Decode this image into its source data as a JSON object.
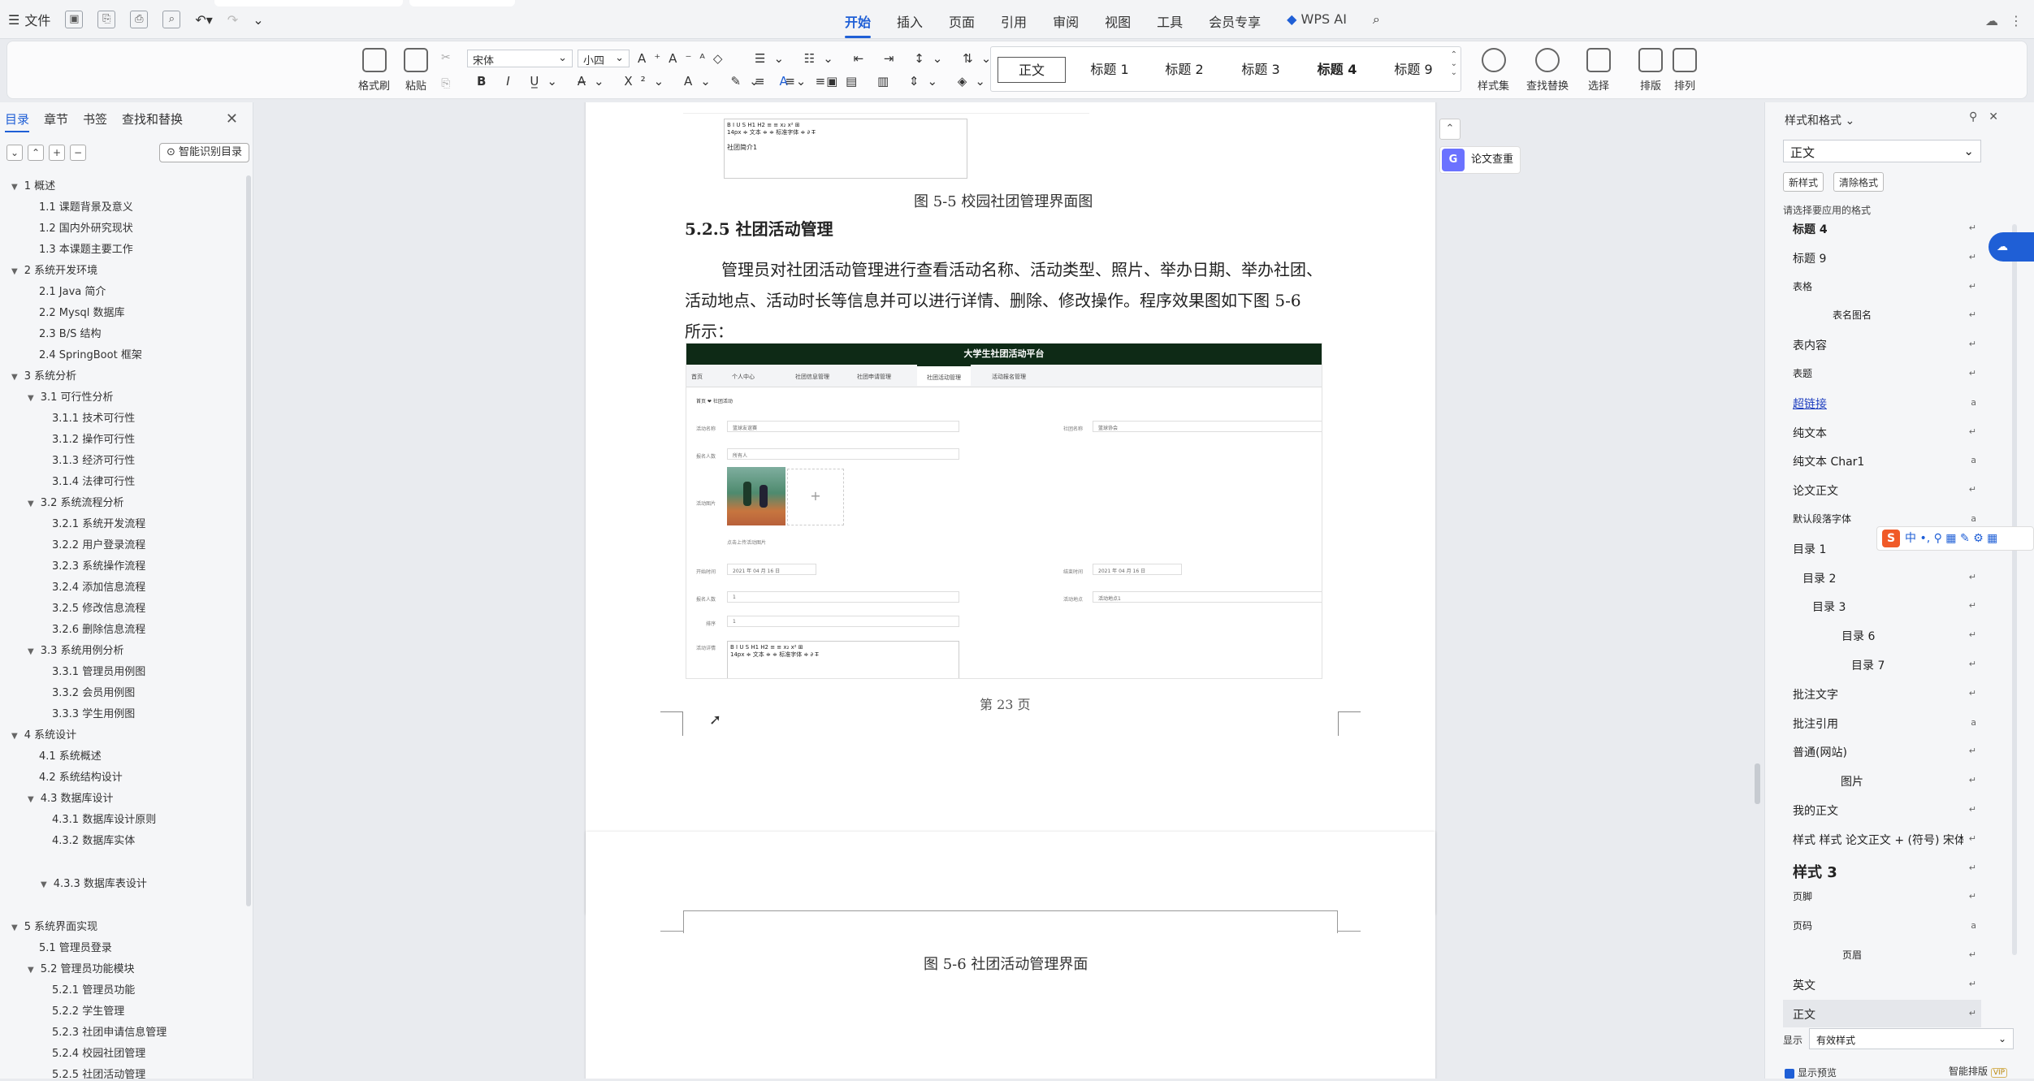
{
  "titlebar": {
    "file_label": "文件",
    "menu": [
      "开始",
      "插入",
      "页面",
      "引用",
      "审阅",
      "视图",
      "工具",
      "会员专享"
    ],
    "active_menu": "开始",
    "wps_ai": "WPS AI"
  },
  "ribbon": {
    "groups": {
      "format_painter": "格式刷",
      "paste": "粘贴",
      "styles_set": "样式集",
      "find_replace": "查找替换",
      "select": "选择",
      "layout": "排版",
      "arrange": "排列"
    },
    "font_name": "宋体",
    "font_size": "小四",
    "style_gallery": [
      "正文",
      "标题 1",
      "标题 2",
      "标题 3",
      "标题 4",
      "标题 9"
    ],
    "selected_style": "正文"
  },
  "leftnav": {
    "tabs": [
      "目录",
      "章节",
      "书签",
      "查找和替换"
    ],
    "active_tab": "目录",
    "smart_button": "智能识别目录",
    "toc": [
      {
        "label": "1  概述",
        "level": 0,
        "tri": "▼"
      },
      {
        "label": "1.1 课题背景及意义",
        "level": 1
      },
      {
        "label": "1.2  国内外研究现状",
        "level": 1
      },
      {
        "label": "1.3  本课题主要工作",
        "level": 1
      },
      {
        "label": "2  系统开发环境",
        "level": 0,
        "tri": "▼"
      },
      {
        "label": "2.1 Java 简介",
        "level": 1
      },
      {
        "label": "2.2 Mysql 数据库",
        "level": 1
      },
      {
        "label": "2.3 B/S 结构",
        "level": 1
      },
      {
        "label": "2.4 SpringBoot 框架",
        "level": 1
      },
      {
        "label": "3  系统分析",
        "level": 0,
        "tri": "▼"
      },
      {
        "label": "3.1  可行性分析",
        "level": 1,
        "tri": "▼"
      },
      {
        "label": "3.1.1  技术可行性",
        "level": 2
      },
      {
        "label": "3.1.2 操作可行性",
        "level": 2
      },
      {
        "label": "3.1.3  经济可行性",
        "level": 2
      },
      {
        "label": "3.1.4  法律可行性",
        "level": 2
      },
      {
        "label": "3.2 系统流程分析",
        "level": 1,
        "tri": "▼"
      },
      {
        "label": "3.2.1 系统开发流程",
        "level": 2
      },
      {
        "label": "3.2.2  用户登录流程",
        "level": 2
      },
      {
        "label": "3.2.3  系统操作流程",
        "level": 2
      },
      {
        "label": "3.2.4  添加信息流程",
        "level": 2
      },
      {
        "label": "3.2.5  修改信息流程",
        "level": 2
      },
      {
        "label": "3.2.6  删除信息流程",
        "level": 2
      },
      {
        "label": "3.3 系统用例分析",
        "level": 1,
        "tri": "▼"
      },
      {
        "label": "3.3.1 管理员用例图",
        "level": 2
      },
      {
        "label": "3.3.2 会员用例图",
        "level": 2
      },
      {
        "label": "3.3.3 学生用例图",
        "level": 2
      },
      {
        "label": "4  系统设计",
        "level": 0,
        "tri": "▼"
      },
      {
        "label": "4.1  系统概述",
        "level": 1
      },
      {
        "label": "4.2  系统结构设计",
        "level": 1
      },
      {
        "label": "4.3 数据库设计",
        "level": 1,
        "tri": "▼"
      },
      {
        "label": "4.3.1  数据库设计原则",
        "level": 2
      },
      {
        "label": "4.3.2  数据库实体",
        "level": 2
      },
      {
        "label": "",
        "level": 2,
        "gap": true
      },
      {
        "label": "4.3.3  数据库表设计",
        "level": 2,
        "tri": "▼"
      },
      {
        "label": "",
        "level": 2,
        "gap": true
      },
      {
        "label": "5 系统界面实现",
        "level": 0,
        "tri": "▼"
      },
      {
        "label": "5.1  管理员登录",
        "level": 1
      },
      {
        "label": "5.2   管理员功能模块",
        "level": 1,
        "tri": "▼"
      },
      {
        "label": "5.2.1  管理员功能",
        "level": 2
      },
      {
        "label": "5.2.2 学生管理",
        "level": 2
      },
      {
        "label": "5.2.3  社团申请信息管理",
        "level": 2
      },
      {
        "label": "5.2.4 校园社团管理",
        "level": 2
      },
      {
        "label": "5.2.5 社团活动管理",
        "level": 2
      }
    ]
  },
  "document": {
    "prev_caption": "图 5-5 校园社团管理界面图",
    "heading": "5.2.5 社团活动管理",
    "paragraph_lines": [
      "管理员对社团活动管理进行查看活动名称、活动类型、照片、举办日期、举办社团、",
      "活动地点、活动时长等信息并可以进行详情、删除、修改操作。程序效果图如下图 5-6",
      "所示："
    ],
    "page_number": "第 23 页",
    "next_caption": "图 5-6 社团活动管理界面",
    "screenshot": {
      "title": "大学生社团活动平台",
      "nav": [
        "首页",
        "个人中心",
        "社团信息管理",
        "社团申请管理",
        "社团活动管理",
        "活动报名管理"
      ],
      "active_nav": "社团活动管理",
      "breadcrumb": "首页 ❤ 社团活动",
      "fields": {
        "activity_name_label": "活动名称",
        "activity_name": "篮球友谊赛",
        "club_name_label": "社团名称",
        "club_name": "篮球协会",
        "count_label": "报名人数",
        "count": "所有人",
        "photo_label": "活动图片",
        "photo_hint": "点击上传活动图片",
        "start_label": "开始时间",
        "start": "2021 年 04 月 16 日",
        "end_label": "结束时间",
        "end": "2021 年 04 月 16 日",
        "joined_label": "报名人数",
        "joined": "1",
        "place_label": "活动地点",
        "place": "活动地点1",
        "sort_label": "排序",
        "sort": "1",
        "detail_label": "活动详情"
      },
      "editor_tools": "B  I  U  S   H1  H2  ≡  ≡   x₂  x²   ⊞",
      "editor_tools2": "14px   ≑   文本   ≑   ≑   标准字体   ≑   ∂   T̶"
    },
    "prev_shot_text": "社团简介1"
  },
  "floating": {
    "paper_check": "论文查重"
  },
  "styles_panel": {
    "title": "样式和格式",
    "current": "正文",
    "new_style": "新样式",
    "clear_format": "清除格式",
    "hint": "请选择要应用的格式",
    "items": [
      {
        "label": "标题 4",
        "bold": true,
        "indent": 0,
        "mk": "↵"
      },
      {
        "label": "标题  9",
        "indent": 0,
        "mk": "↵"
      },
      {
        "label": "表格",
        "indent": 0,
        "small": true,
        "mk": "↵"
      },
      {
        "label": "表名图名",
        "indent": 0,
        "center": true,
        "small": true,
        "mk": "↵"
      },
      {
        "label": "表内容",
        "indent": 0,
        "mk": "↵"
      },
      {
        "label": "表题",
        "indent": 0,
        "small": true,
        "mk": "↵"
      },
      {
        "label": "超链接",
        "indent": 0,
        "link": true,
        "mk": "a"
      },
      {
        "label": "纯文本",
        "indent": 0,
        "mk": "↵"
      },
      {
        "label": "纯文本 Char1",
        "indent": 0,
        "mk": "a"
      },
      {
        "label": "论文正文",
        "indent": 0,
        "mk": "↵"
      },
      {
        "label": "默认段落字体",
        "indent": 0,
        "small": true,
        "mk": "a"
      },
      {
        "label": "目录 1",
        "indent": 0,
        "mk": "↵"
      },
      {
        "label": "目录 2",
        "indent": 12,
        "mk": "↵"
      },
      {
        "label": "目录 3",
        "indent": 24,
        "mk": "↵"
      },
      {
        "label": "目录 6",
        "indent": 60,
        "mk": "↵"
      },
      {
        "label": "目录 7",
        "indent": 72,
        "mk": "↵"
      },
      {
        "label": "批注文字",
        "indent": 0,
        "mk": "↵"
      },
      {
        "label": "批注引用",
        "indent": 0,
        "mk": "a"
      },
      {
        "label": "普通(网站)",
        "indent": 0,
        "mk": "↵"
      },
      {
        "label": "图片",
        "indent": 0,
        "center": true,
        "mk": "↵"
      },
      {
        "label": "我的正文",
        "indent": 0,
        "mk": "↵"
      },
      {
        "label": "样式  样式  论文正文 + (符号) 宋体",
        "indent": 0,
        "mk": "↵"
      },
      {
        "label": "样式 3",
        "indent": 0,
        "bold": true,
        "big": true,
        "mk": "↵"
      },
      {
        "label": "页脚",
        "indent": 0,
        "small": true,
        "mk": "↵"
      },
      {
        "label": "页码",
        "indent": 0,
        "small": true,
        "mk": "a"
      },
      {
        "label": "页眉",
        "indent": 0,
        "center": true,
        "small": true,
        "mk": "↵"
      },
      {
        "label": "英文",
        "indent": 0,
        "mk": "↵"
      },
      {
        "label": "正文",
        "indent": 0,
        "mk": "↵",
        "selected": true
      }
    ],
    "show_label": "显示",
    "show_value": "有效样式",
    "preview_label": "显示预览",
    "smart_format": "智能排版",
    "vip": "VIP"
  },
  "ime": {
    "text": "中  •,  ⚲  ▦  ✎  ⚙  ▦"
  },
  "colors": {
    "accent": "#1f5fd6",
    "app_header_green": "#0e2a16"
  }
}
